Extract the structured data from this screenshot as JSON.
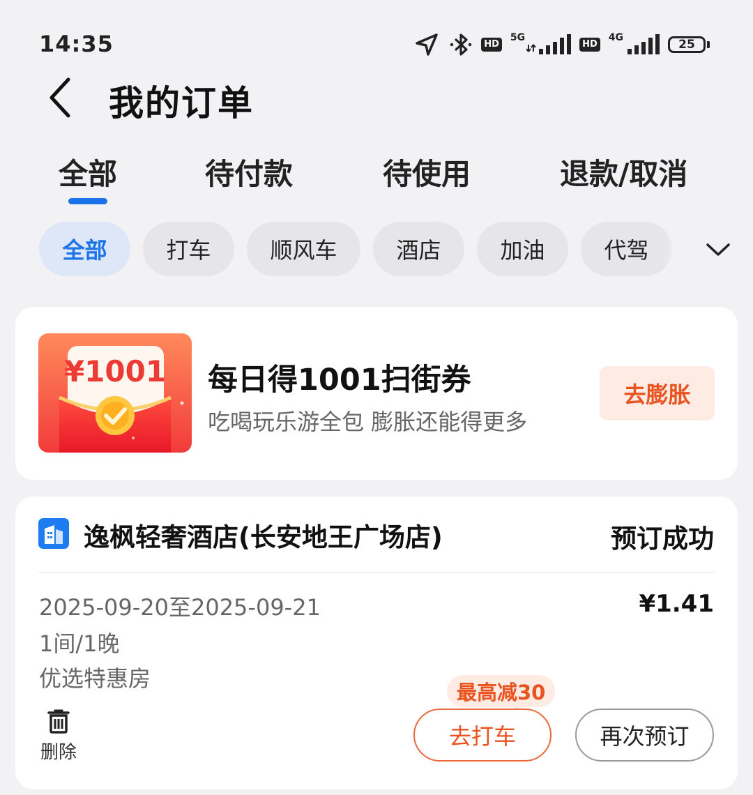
{
  "status_bar": {
    "time": "14:35",
    "icons": [
      "location-icon",
      "bluetooth-icon",
      "hd-icon",
      "5g-signal-icon",
      "hd-icon",
      "4g-signal-icon",
      "battery-icon"
    ],
    "hd_label": "HD",
    "net1": "5G",
    "net2": "4G",
    "battery": "25"
  },
  "header": {
    "back_icon": "chevron-left-icon",
    "title": "我的订单"
  },
  "tabs": [
    {
      "label": "全部",
      "active": true
    },
    {
      "label": "待付款",
      "active": false
    },
    {
      "label": "待使用",
      "active": false
    },
    {
      "label": "退款/取消",
      "active": false
    }
  ],
  "chips": [
    {
      "label": "全部",
      "active": true
    },
    {
      "label": "打车",
      "active": false
    },
    {
      "label": "顺风车",
      "active": false
    },
    {
      "label": "酒店",
      "active": false
    },
    {
      "label": "加油",
      "active": false
    },
    {
      "label": "代驾",
      "active": false
    }
  ],
  "chips_expand_icon": "chevron-down-icon",
  "promo": {
    "image_text": "¥1001",
    "title": "每日得1001扫街券",
    "subtitle": "吃喝玩乐游全包 膨胀还能得更多",
    "button": "去膨胀"
  },
  "order": {
    "icon": "hotel-icon",
    "hotel_name": "逸枫轻奢酒店(长安地王广场店)",
    "status": "预订成功",
    "dates": "2025-09-20至2025-09-21",
    "price": "¥1.41",
    "rooms": "1间/1晚",
    "room_type": "优选特惠房",
    "delete_label": "删除",
    "promo_tag": "最高减30",
    "taxi_button": "去打车",
    "rebook_button": "再次预订"
  },
  "colors": {
    "accent_blue": "#1a73e8",
    "accent_orange": "#e8531f",
    "background": "#f2f2f4"
  }
}
